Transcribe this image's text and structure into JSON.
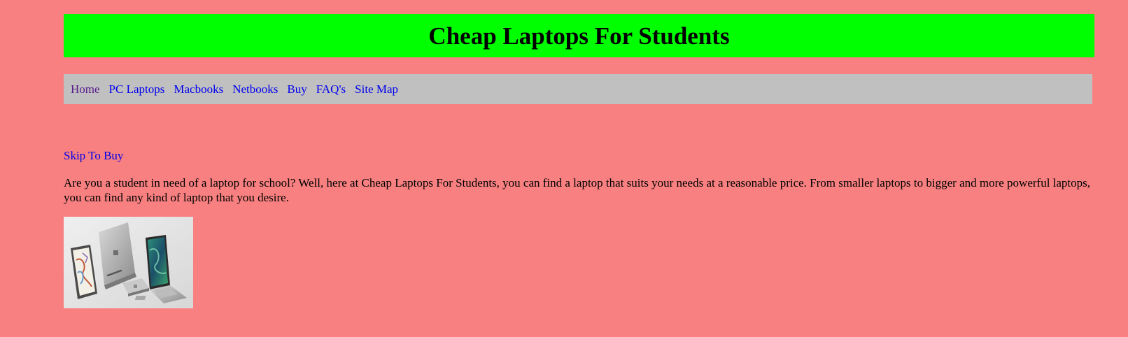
{
  "header": {
    "title": "Cheap Laptops For Students"
  },
  "nav": {
    "items": [
      {
        "label": "Home"
      },
      {
        "label": "PC Laptops"
      },
      {
        "label": "Macbooks"
      },
      {
        "label": "Netbooks"
      },
      {
        "label": "Buy"
      },
      {
        "label": "FAQ's"
      },
      {
        "label": "Site Map"
      }
    ]
  },
  "main": {
    "skip_link": "Skip To Buy",
    "intro": "Are you a student in need of a laptop for school? Well, here at Cheap Laptops For Students, you can find a laptop that suits your needs at a reasonable price. From smaller laptops to bigger and more powerful laptops, you can find any kind of laptop that you desire."
  },
  "colors": {
    "page_background": "#f88080",
    "header_background": "#00ff00",
    "nav_background": "#c0c0c0",
    "link": "#0000ee",
    "visited_link": "#551a8b"
  }
}
